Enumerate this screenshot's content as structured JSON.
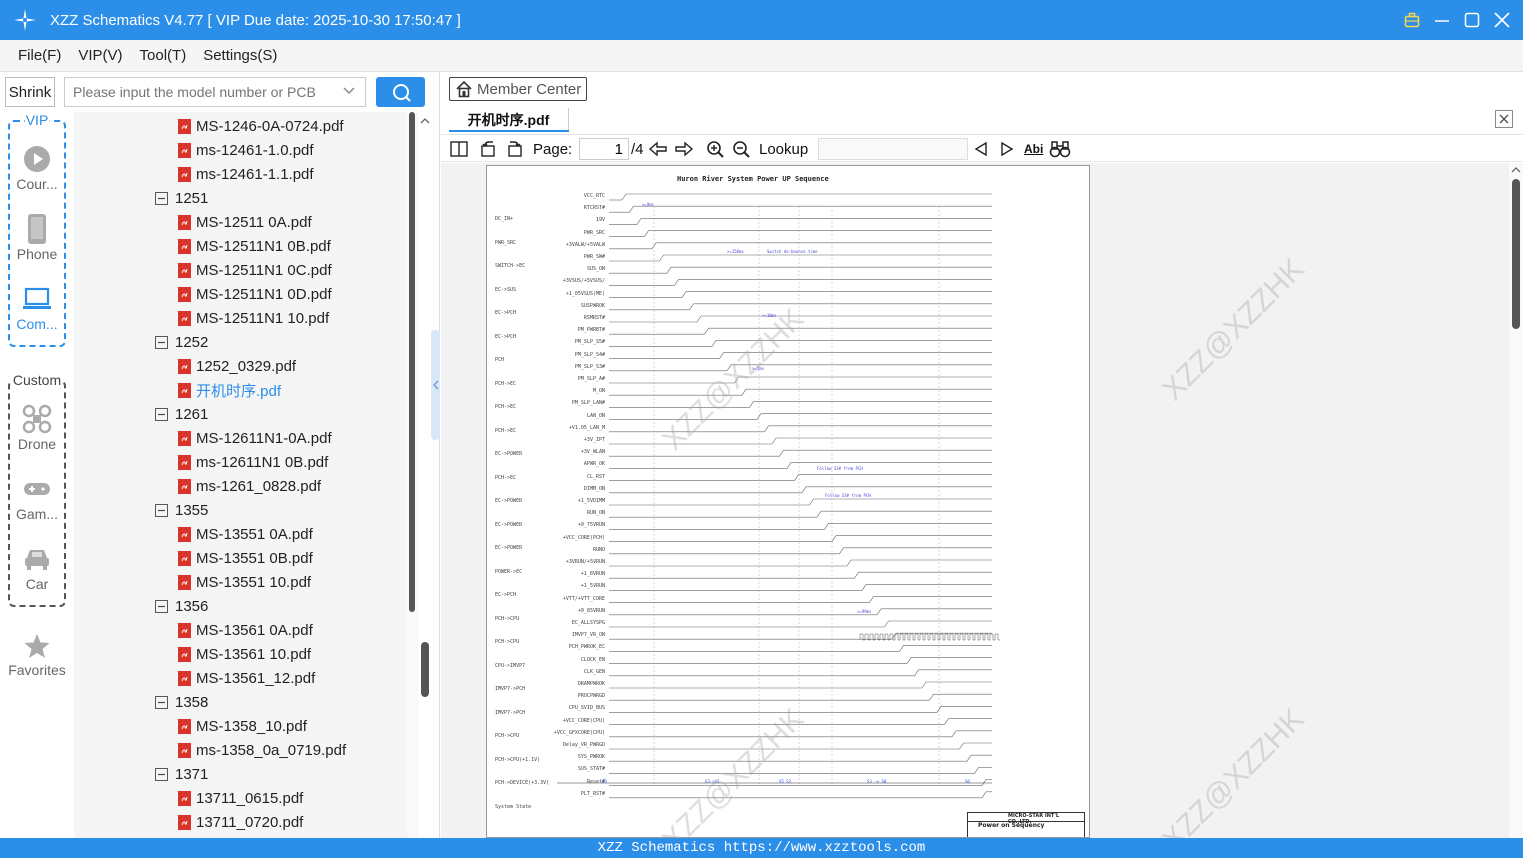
{
  "window": {
    "title": "XZZ Schematics V4.77 [ VIP Due date: 2025-10-30 17:50:47 ]",
    "icons": [
      "logo-icon",
      "briefcase-icon",
      "minimize-icon",
      "maximize-icon",
      "close-icon"
    ]
  },
  "menu": [
    "File(F)",
    "VIP(V)",
    "Tool(T)",
    "Settings(S)"
  ],
  "left": {
    "shrink_label": "Shrink",
    "search_placeholder": "Please input the model number or PCB",
    "vip_label": "VIP",
    "custom_label": "Custom",
    "vip_items": [
      "Cour...",
      "Phone",
      "Com..."
    ],
    "custom_items": [
      "Drone",
      "Gam...",
      "Car"
    ],
    "favorites_label": "Favorites"
  },
  "tree": [
    {
      "type": "file",
      "label": "MS-1246-0A-0724.pdf"
    },
    {
      "type": "file",
      "label": "ms-12461-1.0.pdf"
    },
    {
      "type": "file",
      "label": "ms-12461-1.1.pdf"
    },
    {
      "type": "folder",
      "label": "1251"
    },
    {
      "type": "file",
      "label": "MS-12511 0A.pdf"
    },
    {
      "type": "file",
      "label": "MS-12511N1 0B.pdf"
    },
    {
      "type": "file",
      "label": "MS-12511N1 0C.pdf"
    },
    {
      "type": "file",
      "label": "MS-12511N1 0D.pdf"
    },
    {
      "type": "file",
      "label": "MS-12511N1 10.pdf"
    },
    {
      "type": "folder",
      "label": "1252"
    },
    {
      "type": "file",
      "label": "1252_0329.pdf"
    },
    {
      "type": "file",
      "label": "开机时序.pdf",
      "highlight": true
    },
    {
      "type": "folder",
      "label": "1261"
    },
    {
      "type": "file",
      "label": "MS-12611N1-0A.pdf"
    },
    {
      "type": "file",
      "label": "ms-12611N1 0B.pdf"
    },
    {
      "type": "file",
      "label": "ms-1261_0828.pdf"
    },
    {
      "type": "folder",
      "label": "1355"
    },
    {
      "type": "file",
      "label": "MS-13551 0A.pdf"
    },
    {
      "type": "file",
      "label": "MS-13551 0B.pdf"
    },
    {
      "type": "file",
      "label": "MS-13551 10.pdf"
    },
    {
      "type": "folder",
      "label": "1356"
    },
    {
      "type": "file",
      "label": "MS-13561 0A.pdf"
    },
    {
      "type": "file",
      "label": "MS-13561 10.pdf"
    },
    {
      "type": "file",
      "label": "MS-13561_12.pdf"
    },
    {
      "type": "folder",
      "label": "1358"
    },
    {
      "type": "file",
      "label": "MS-1358_10.pdf"
    },
    {
      "type": "file",
      "label": "ms-1358_0a_0719.pdf"
    },
    {
      "type": "folder",
      "label": "1371"
    },
    {
      "type": "file",
      "label": "13711_0615.pdf"
    },
    {
      "type": "file",
      "label": "13711_0720.pdf"
    }
  ],
  "right": {
    "member_center": "Member Center",
    "tab_label": "开机时序.pdf",
    "page_label": "Page:",
    "page_current": "1",
    "page_total": "/4",
    "lookup_label": "Lookup",
    "abi_label": "Abi"
  },
  "schematic": {
    "title": "Huron River System Power UP Sequence",
    "signals": [
      "VCC_RTC",
      "RTCRST#",
      "19V",
      "PWR_SRC",
      "+3VALW/+5VALW",
      "PWR_SW#",
      "SUS_ON",
      "+3VSUS/+5VSUS/",
      "+1_05VSUS(ME)",
      "SUSPWROK",
      "RSMRST#",
      "PM_PWRBT#",
      "PM_SLP_S5#",
      "PM_SLP_S4#",
      "PM_SLP_S3#",
      "PM_SLP_A#",
      "M_ON",
      "PM_SLP_LAN#",
      "LAN_ON",
      "+V1.05_LAN_M",
      "+3V_IPT",
      "+3V_WLAN",
      "APWR_OK",
      "CL_RST",
      "DIMM_ON",
      "+1_5VDIMM",
      "RUN_ON",
      "+0_75VRUN",
      "+VCC_CORE(PCH)",
      "RUNO",
      "+3VRUN/+5VRUN",
      "+1_8VRUN",
      "+1_5VRUN",
      "+VTT/+VTT_CORE",
      "+0_85VRUN",
      "EC_ALLSYSPG",
      "IMVP7_VR_ON",
      "PCH_PWROK_EC",
      "CLOCK_EN",
      "CLK_GEN",
      "DRAMPWROK",
      "PROCPWRGD",
      "CPU_SVID_BUS",
      "+VCC_CORE(CPU)",
      "+VCC_GFXCORE(CPU)",
      "Delay_VR_PWRGD",
      "SYS_PWROK",
      "SUS_STAT#",
      "Reset#",
      "PLT_RST#"
    ],
    "sources": [
      "DC_IN+",
      "PWR_SRC",
      "SWITCH->EC",
      "EC->SUS",
      "EC->PCH",
      "EC->PCH",
      "PCH",
      "PCH->EC",
      "PCH->EC",
      "PCH->EC",
      "EC->POWER",
      "PCH->EC",
      "EC->POWER",
      "EC->POWER",
      "EC->POWER",
      "POWER->EC",
      "EC->PCH",
      "PCH->CPU",
      "PCH->CPU",
      "CPU->IMVP7",
      "IMVP7->PCH",
      "IMVP7->PCH",
      "PCH->CPU",
      "PCH->CPU(+1.1V)",
      "PCH->DEVICE(+3.3V)",
      "System State"
    ],
    "states": [
      "G3",
      "G3->S5",
      "S5 S3",
      "S3 -> S0",
      "S0"
    ],
    "notes": [
      ">=9ms",
      ">=150ms",
      "Switch de-bounce time",
      ">=10ms",
      ">=5ms",
      ">=99ms",
      "Follow S3# from PCH",
      "Follow S3# from PCH"
    ],
    "titleblock_company": "MICRO-STAR INT'L CO.,LTD.",
    "titleblock_doc": "Power on Sequency",
    "watermark": "XZZ@XZZHK"
  },
  "status": "XZZ Schematics https://www.xzztools.com",
  "colors": {
    "accent": "#2b8ee8",
    "pdf_icon": "#d9342b",
    "link": "#2b8ee8"
  }
}
